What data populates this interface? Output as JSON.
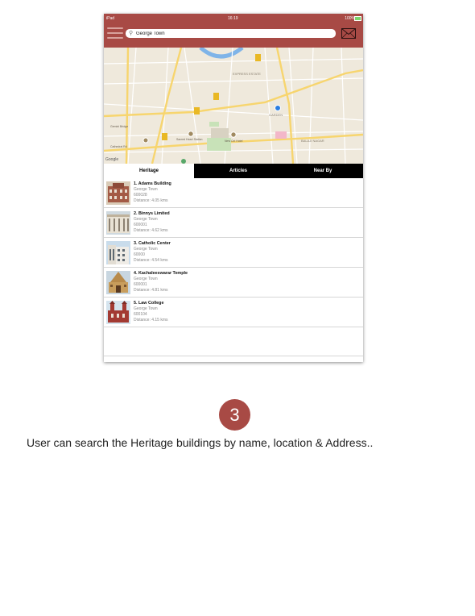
{
  "status_bar": {
    "carrier": "iPad ",
    "time": "16:19",
    "battery": "100%"
  },
  "search": {
    "value": "George Town"
  },
  "map": {
    "labels": [
      "EXPRESS ESTATE",
      "GARDEN",
      "BALAJI NAGAR",
      "Sacred Heart Station",
      "New Cel Hotel",
      "Gemini Bridge",
      "Cathedral Rd"
    ],
    "google": "Google"
  },
  "tabs": [
    {
      "label": "Heritage",
      "active": true
    },
    {
      "label": "Articles",
      "active": false
    },
    {
      "label": "Near By",
      "active": false
    }
  ],
  "items": [
    {
      "name": "1. Adams Building",
      "area": "George Town",
      "pin": "600028",
      "distance": "Distance: 4.05 kms"
    },
    {
      "name": "2. Binnys Limited",
      "area": "George Town",
      "pin": "600001",
      "distance": "Distance: 4.62 kms"
    },
    {
      "name": "3. Catholic Center",
      "area": "George Town",
      "pin": "60000",
      "distance": "Distance: 4.54 kms"
    },
    {
      "name": "4. Kachaleeswarar Temple",
      "area": "George Town",
      "pin": "600001",
      "distance": "Distance: 4.81 kms"
    },
    {
      "name": "5. Law College",
      "area": "George Town",
      "pin": "600104",
      "distance": "Distance: 4.15 kms"
    }
  ],
  "step": {
    "number": "3",
    "caption": "User can search the Heritage buildings by name, location & Address.."
  },
  "colors": {
    "header": "#a84a45",
    "accent_blue": "#2a7de1"
  }
}
